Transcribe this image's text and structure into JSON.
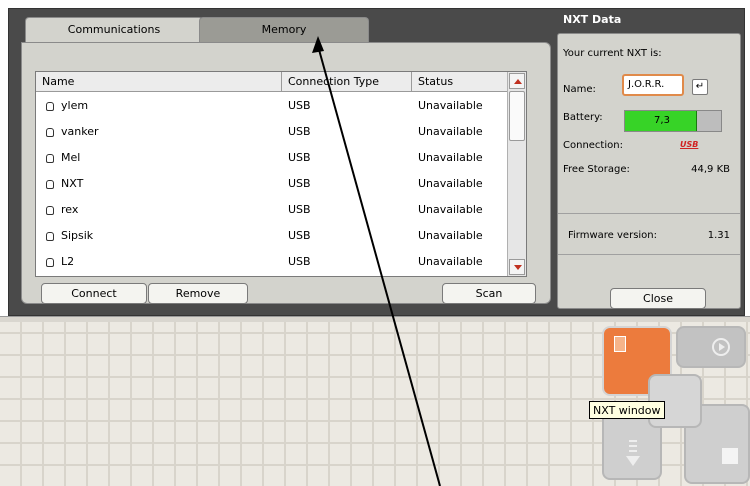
{
  "tabs": [
    {
      "label": "Communications",
      "active": true
    },
    {
      "label": "Memory",
      "active": false
    }
  ],
  "device_list": {
    "columns": [
      "Name",
      "Connection Type",
      "Status"
    ],
    "rows": [
      {
        "name": "ylem",
        "connection": "USB",
        "status": "Unavailable"
      },
      {
        "name": "vanker",
        "connection": "USB",
        "status": "Unavailable"
      },
      {
        "name": "Mel",
        "connection": "USB",
        "status": "Unavailable"
      },
      {
        "name": "NXT",
        "connection": "USB",
        "status": "Unavailable"
      },
      {
        "name": "rex",
        "connection": "USB",
        "status": "Unavailable"
      },
      {
        "name": "Sipsik",
        "connection": "USB",
        "status": "Unavailable"
      },
      {
        "name": "L2",
        "connection": "USB",
        "status": "Unavailable"
      }
    ]
  },
  "buttons": {
    "connect": "Connect",
    "remove": "Remove",
    "scan": "Scan",
    "close": "Close"
  },
  "nxt_data": {
    "title": "NXT Data",
    "current_label": "Your current NXT is:",
    "name_label": "Name:",
    "name_value": "J.O.R.R.",
    "enter_icon": "↵",
    "battery_label": "Battery:",
    "battery_value": "7,3",
    "battery_level": 0.75,
    "connection_label": "Connection:",
    "connection_value": "USB",
    "storage_label": "Free Storage:",
    "storage_value": "44,9 KB",
    "firmware_label": "Firmware version:",
    "firmware_value": "1.31"
  },
  "controller": {
    "tooltip": "NXT window"
  },
  "colors": {
    "accent_orange": "#ec7b3d",
    "battery_green": "#37d327",
    "usb_red": "#d02020"
  }
}
